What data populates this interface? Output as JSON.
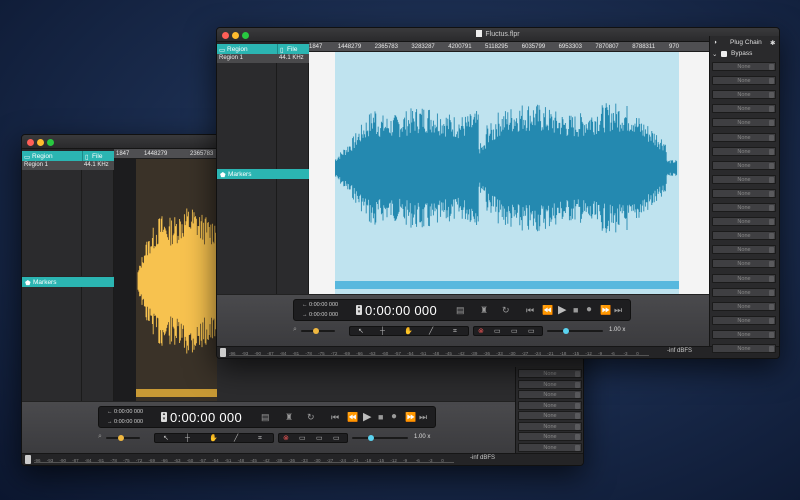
{
  "back_window": {
    "region_header": "Region",
    "file_header": "File",
    "row_region": "Region 1",
    "row_file": "44.1 KHz ...",
    "markers_label": "Markers",
    "ruler_ticks": [
      "1847",
      "1448279",
      "2365783"
    ],
    "counter_top": "0:00:00 000",
    "counter_bottom": "0:00:00 000",
    "main_time": "0:00:00 000",
    "zoom_value": "1.00 x",
    "meter_label": "-inf dBFS",
    "meter_ticks": [
      "-96",
      "-93",
      "-90",
      "-87",
      "-84",
      "-81",
      "-78",
      "-75",
      "-72",
      "-69",
      "-66",
      "-63",
      "-60",
      "-57",
      "-54",
      "-51",
      "-48",
      "-45",
      "-42",
      "-39",
      "-36",
      "-33",
      "-30",
      "-27",
      "-24",
      "-21",
      "-18",
      "-15",
      "-12",
      "-9",
      "-6",
      "-3",
      "0"
    ],
    "plug_slots": [
      "None",
      "None",
      "None",
      "None",
      "None",
      "None",
      "None",
      "None"
    ],
    "waveform_color": "#f7c24f"
  },
  "front_window": {
    "title": "Fluctus.flpr",
    "region_header": "Region",
    "file_header": "File",
    "row_region": "Region 1",
    "row_file": "44.1 KHz ...",
    "markers_label": "Markers",
    "ruler_ticks": [
      "1847",
      "1448279",
      "2365783",
      "3283287",
      "4200791",
      "5118295",
      "6035799",
      "6953303",
      "7870807",
      "8788311",
      "970"
    ],
    "counter_top": "0:00:00 000",
    "counter_bottom": "0:00:00 000",
    "main_time": "0:00:00 000",
    "zoom_value": "1.00 x",
    "meter_label": "-inf dBFS",
    "meter_ticks": [
      "-96",
      "-93",
      "-90",
      "-87",
      "-84",
      "-81",
      "-78",
      "-75",
      "-72",
      "-69",
      "-66",
      "-63",
      "-60",
      "-57",
      "-54",
      "-51",
      "-48",
      "-45",
      "-42",
      "-39",
      "-36",
      "-33",
      "-30",
      "-27",
      "-24",
      "-21",
      "-18",
      "-15",
      "-12",
      "-9",
      "-6",
      "-3",
      "0"
    ],
    "plug_chain_title": "Plug Chain",
    "bypass_label": "Bypass",
    "plug_slots": [
      "None",
      "None",
      "None",
      "None",
      "None",
      "None",
      "None",
      "None",
      "None",
      "None",
      "None",
      "None",
      "None",
      "None",
      "None",
      "None",
      "None",
      "None",
      "None",
      "None",
      "None"
    ],
    "waveform_color": "#2489b0",
    "waveform_bg": "#bfe3ef"
  },
  "icons": {
    "prev": "⏮",
    "rewind": "⏪",
    "play": "▶",
    "stop": "■",
    "record": "●",
    "forward": "⏩",
    "next": "⏭",
    "loop": "↻",
    "pointer": "➚",
    "zoom": "🔍"
  }
}
